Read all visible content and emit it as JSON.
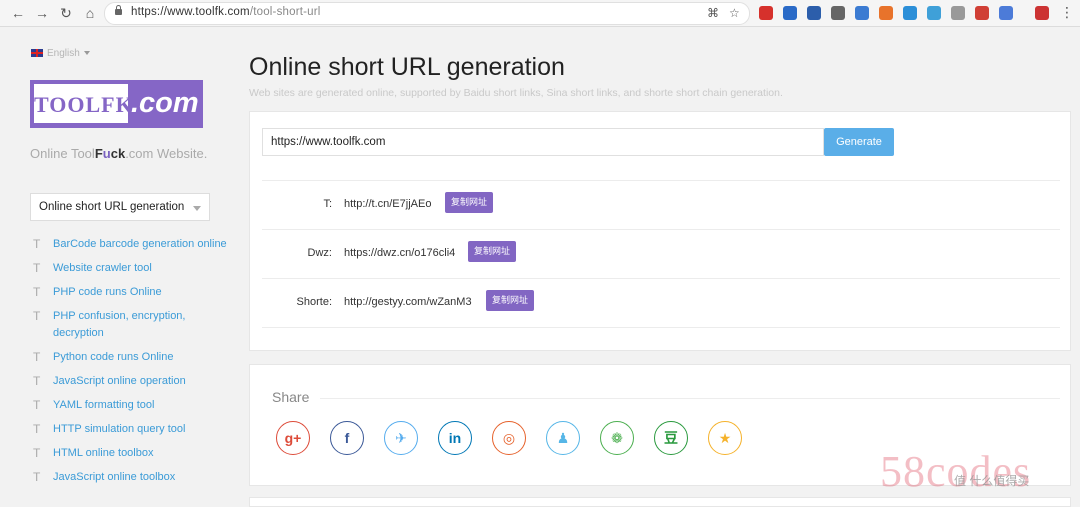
{
  "browser": {
    "url_host": "https://www.toolfk.com",
    "url_path": "/tool-short-url",
    "ext_colors": [
      "#d6312c",
      "#2a6ac7",
      "#2c5eab",
      "#666666",
      "#3b7bd2",
      "#e8732b",
      "#2c8fd8",
      "#3fa0d8",
      "#999999",
      "#d03f35",
      "#4c7bd8",
      "#cc3333"
    ]
  },
  "sidebar": {
    "language": "English",
    "logo_main": "TOOLFK",
    "logo_suffix": ".com",
    "tagline_pre": "Online Tool",
    "tagline_f": "F",
    "tagline_u": "u",
    "tagline_ck": "ck",
    "tagline_post": ".com Website.",
    "select_value": "Online short URL generation",
    "menu_marker": "T",
    "menu": [
      "BarCode barcode generation online",
      "Website crawler tool",
      "PHP code runs Online",
      "PHP confusion, encryption, decryption",
      "Python code runs Online",
      "JavaScript online operation",
      "YAML formatting tool",
      "HTTP simulation query tool",
      "HTML online toolbox",
      "JavaScript online toolbox"
    ]
  },
  "main": {
    "title": "Online short URL generation",
    "subtitle": "Web sites are generated online, supported by Baidu short links, Sina short links, and shorte short chain generation.",
    "input_value": "https://www.toolfk.com",
    "generate_label": "Generate",
    "results": [
      {
        "label": "T:",
        "value": "http://t.cn/E7jjAEo",
        "copy": "复制网址"
      },
      {
        "label": "Dwz:",
        "value": "https://dwz.cn/o176cli4",
        "copy": "复制网址"
      },
      {
        "label": "Shorte:",
        "value": "http://gestyy.com/wZanM3",
        "copy": "复制网址"
      }
    ],
    "share_label": "Share",
    "share_icons": [
      {
        "name": "google-plus-icon",
        "glyph": "g+",
        "color": "#dd4b39"
      },
      {
        "name": "facebook-icon",
        "glyph": "f",
        "color": "#3b5998"
      },
      {
        "name": "twitter-icon",
        "glyph": "✈",
        "color": "#55acee"
      },
      {
        "name": "linkedin-icon",
        "glyph": "in",
        "color": "#0077b5"
      },
      {
        "name": "weibo-icon",
        "glyph": "◎",
        "color": "#e6622c"
      },
      {
        "name": "qq-icon",
        "glyph": "♟",
        "color": "#56b6e7"
      },
      {
        "name": "wechat-icon",
        "glyph": "❁",
        "color": "#4caf50"
      },
      {
        "name": "douban-icon",
        "glyph": "豆",
        "color": "#2a9a3e"
      },
      {
        "name": "qzone-icon",
        "glyph": "★",
        "color": "#f5b22b"
      }
    ]
  },
  "watermark": {
    "text": "58codes",
    "sub": "值 什么值得买"
  }
}
